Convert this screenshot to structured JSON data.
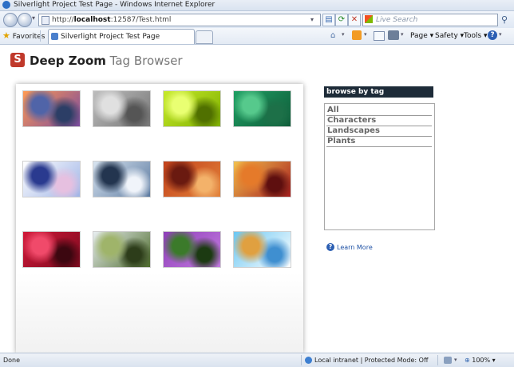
{
  "window": {
    "title": "Silverlight Project Test Page - Windows Internet Explorer"
  },
  "nav": {
    "url_prefix": "http://",
    "url_host": "localhost",
    "url_rest": ":12587/Test.html",
    "search_placeholder": "Live Search"
  },
  "favbar": {
    "favorites_label": "Favorites",
    "tab_title": "Silverlight Project Test Page",
    "commands": {
      "page": "Page ▾",
      "safety": "Safety ▾",
      "tools": "Tools ▾"
    }
  },
  "app": {
    "title_bold": "Deep Zoom",
    "title_light": "Tag Browser",
    "tags_header": "browse by tag",
    "tags": [
      "All",
      "Characters",
      "Landscapes",
      "Plants"
    ],
    "learn_more": "Learn More",
    "images": [
      {
        "name": "sunset-coast",
        "colors": [
          "#ff9a52",
          "#7a4a9e",
          "#5064a8",
          "#2c3e66"
        ]
      },
      {
        "name": "gray-characters",
        "colors": [
          "#bdbdbd",
          "#777777",
          "#e0e0e0",
          "#555555"
        ]
      },
      {
        "name": "green-bubbles",
        "colors": [
          "#c7ea2a",
          "#7fb000",
          "#e9ff72",
          "#507000"
        ]
      },
      {
        "name": "green-leaves",
        "colors": [
          "#1f9f63",
          "#0f5c3a",
          "#56c98c",
          "#1d7048"
        ]
      },
      {
        "name": "cartoon-character",
        "colors": [
          "#ffffff",
          "#9fb4e6",
          "#2a3a8f",
          "#e6c0e0"
        ]
      },
      {
        "name": "mountain-lake",
        "colors": [
          "#d8e4f0",
          "#5c7aa0",
          "#23354f",
          "#f0f4fa"
        ]
      },
      {
        "name": "red-canyon",
        "colors": [
          "#c2411b",
          "#e2823a",
          "#6a1a10",
          "#f3b26a"
        ]
      },
      {
        "name": "autumn-leaves",
        "colors": [
          "#f2c14e",
          "#a61d1d",
          "#e57a2a",
          "#5e0f0f"
        ]
      },
      {
        "name": "red-flower",
        "colors": [
          "#d11a3a",
          "#7c0a1e",
          "#f04a6a",
          "#3c0710"
        ]
      },
      {
        "name": "waterfall",
        "colors": [
          "#e8eef0",
          "#4d6b2c",
          "#9fb46a",
          "#2d3d1a"
        ]
      },
      {
        "name": "purple-thistle",
        "colors": [
          "#8e3fb8",
          "#c37be0",
          "#3b7a2a",
          "#1c3a12"
        ]
      },
      {
        "name": "floating-island",
        "colors": [
          "#6ac6f2",
          "#ffffff",
          "#e0a040",
          "#3f8fd0"
        ]
      }
    ]
  },
  "status": {
    "left": "Done",
    "zone": "Local intranet | Protected Mode: Off",
    "zoom": "100%"
  }
}
